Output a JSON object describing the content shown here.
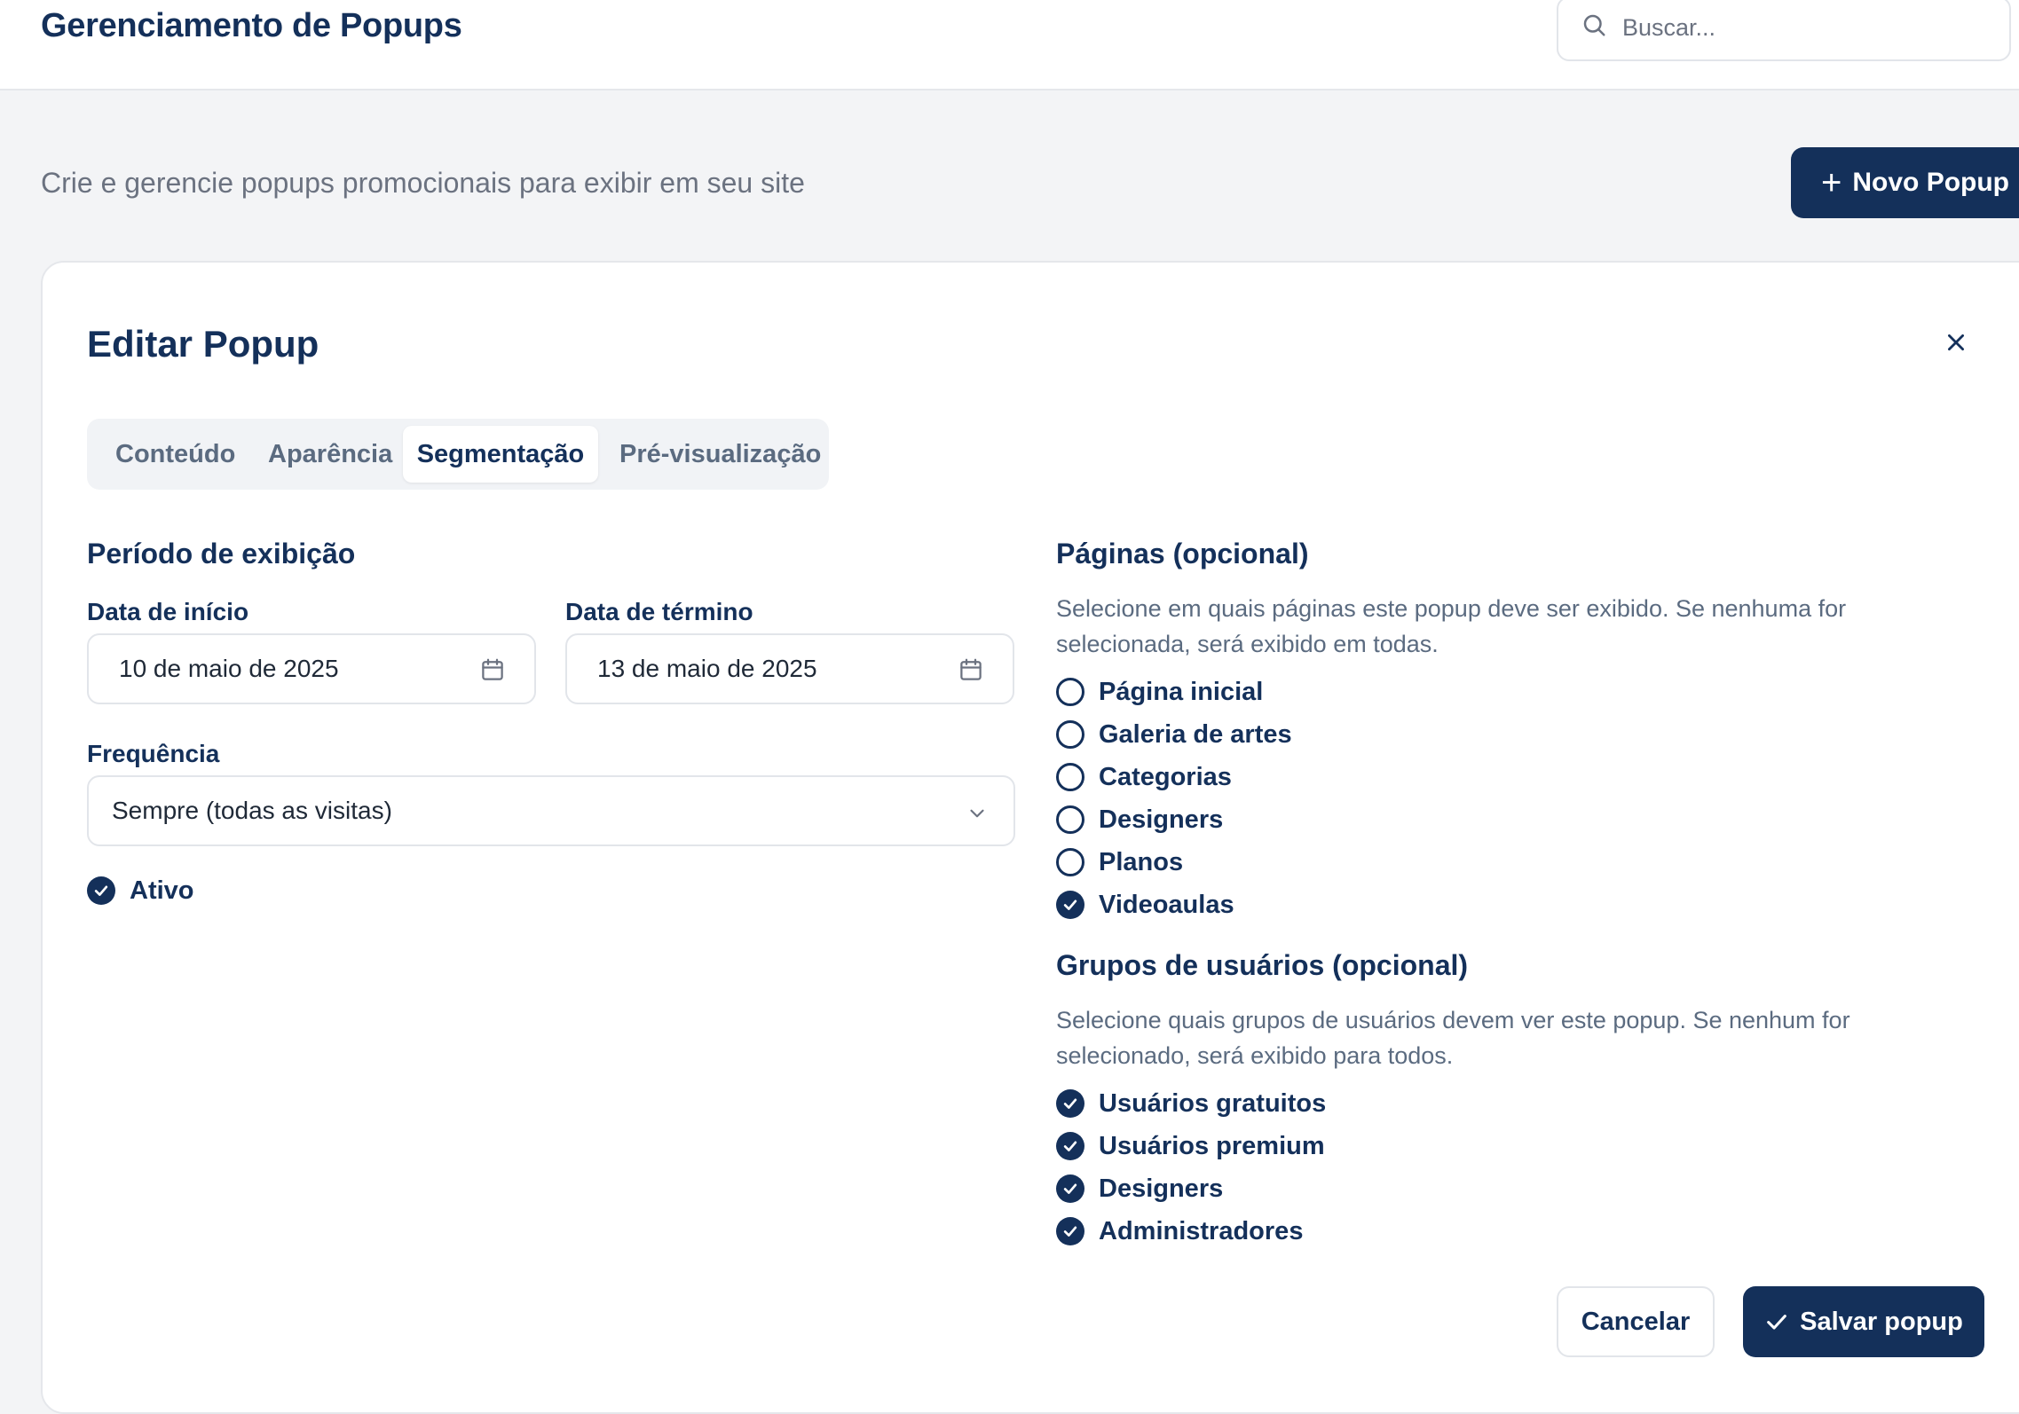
{
  "header": {
    "title": "Gerenciamento de Popups",
    "search_placeholder": "Buscar..."
  },
  "subheader": {
    "description": "Crie e gerencie popups promocionais para exibir em seu site",
    "new_button_label": "Novo Popup"
  },
  "modal": {
    "title": "Editar Popup",
    "tabs": [
      {
        "label": "Conteúdo",
        "active": false
      },
      {
        "label": "Aparência",
        "active": false
      },
      {
        "label": "Segmentação",
        "active": true
      },
      {
        "label": "Pré-visualização",
        "active": false
      }
    ],
    "period": {
      "heading": "Período de exibição",
      "start_label": "Data de início",
      "start_value": "10 de maio de 2025",
      "end_label": "Data de término",
      "end_value": "13 de maio de 2025"
    },
    "frequency": {
      "label": "Frequência",
      "value": "Sempre (todas as visitas)"
    },
    "active": {
      "label": "Ativo",
      "checked": true
    },
    "pages": {
      "heading": "Páginas (opcional)",
      "help": "Selecione em quais páginas este popup deve ser exibido. Se nenhuma for selecionada, será exibido em todas.",
      "items": [
        {
          "label": "Página inicial",
          "checked": false
        },
        {
          "label": "Galeria de artes",
          "checked": false
        },
        {
          "label": "Categorias",
          "checked": false
        },
        {
          "label": "Designers",
          "checked": false
        },
        {
          "label": "Planos",
          "checked": false
        },
        {
          "label": "Videoaulas",
          "checked": true
        }
      ]
    },
    "groups": {
      "heading": "Grupos de usuários (opcional)",
      "help": "Selecione quais grupos de usuários devem ver este popup. Se nenhum for selecionado, será exibido para todos.",
      "items": [
        {
          "label": "Usuários gratuitos",
          "checked": true
        },
        {
          "label": "Usuários premium",
          "checked": true
        },
        {
          "label": "Designers",
          "checked": true
        },
        {
          "label": "Administradores",
          "checked": true
        }
      ]
    },
    "footer": {
      "cancel_label": "Cancelar",
      "save_label": "Salvar popup"
    }
  },
  "colors": {
    "primary": "#14305a",
    "background": "#f3f4f6",
    "muted_text": "#6b7280"
  }
}
